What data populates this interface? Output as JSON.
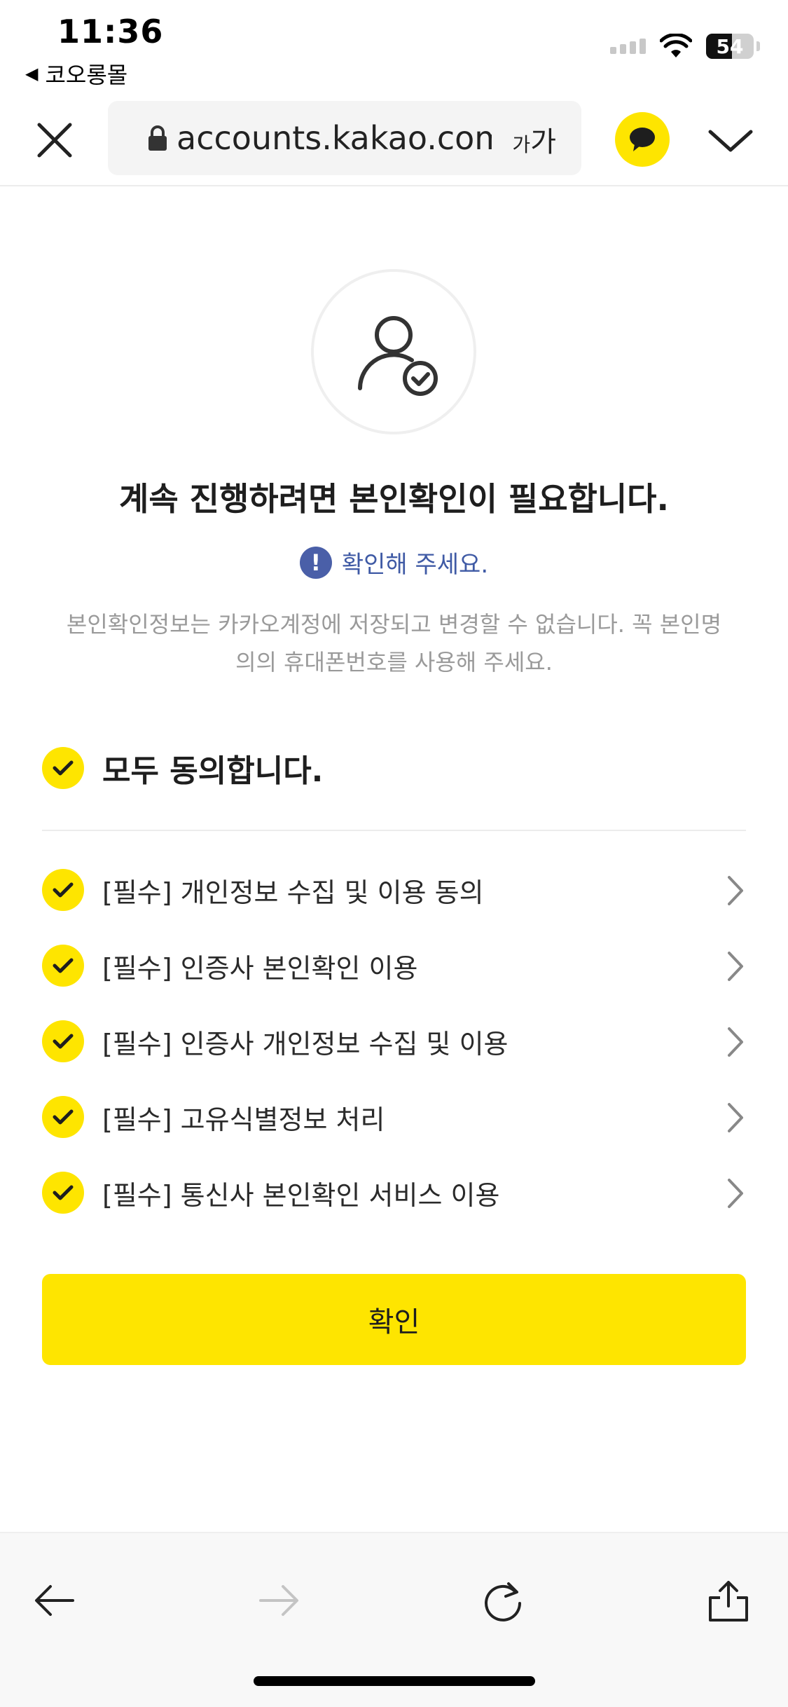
{
  "status_bar": {
    "time": "11:36",
    "back_app": "코오롱몰",
    "battery": "54",
    "battery_level": 0.54
  },
  "browser": {
    "url": "accounts.kakao.com",
    "font_size_label_small": "가",
    "font_size_label_large": "가"
  },
  "main": {
    "heading": "계속 진행하려면 본인확인이 필요합니다.",
    "notice": "확인해 주세요.",
    "notice_icon": "!",
    "description_line1": "본인확인정보는 카카오계정에 저장되고 변경할 수 없습니다. 꼭 본인명",
    "description_line2": "의의 휴대폰번호를 사용해 주세요.",
    "agree_all": "모두 동의합니다.",
    "terms": [
      {
        "label": "[필수] 개인정보 수집 및 이용 동의"
      },
      {
        "label": "[필수] 인증사 본인확인 이용"
      },
      {
        "label": "[필수] 인증사 개인정보 수집 및 이용"
      },
      {
        "label": "[필수] 고유식별정보 처리"
      },
      {
        "label": "[필수] 통신사 본인확인 서비스 이용"
      }
    ],
    "confirm": "확인"
  },
  "colors": {
    "accent": "#fee500",
    "notice": "#3f5aa5",
    "text": "#1e1e1e",
    "muted": "#9a9a9a"
  },
  "icons": {
    "close": "close-icon",
    "lock": "lock-icon",
    "kakao": "kakaotalk-icon",
    "chevron": "chevron-down-icon",
    "avatar": "user-verified-icon",
    "check": "check-icon",
    "arrow": "chevron-right-icon",
    "back": "back-arrow-icon",
    "forward": "forward-arrow-icon",
    "reload": "reload-icon",
    "share": "share-icon"
  }
}
